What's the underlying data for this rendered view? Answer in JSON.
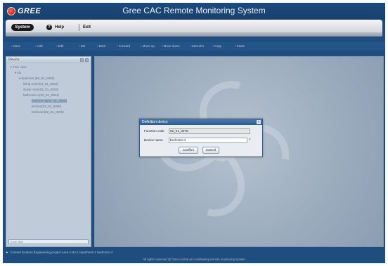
{
  "app": {
    "logo_text": "GREE",
    "title": "Gree CAC Remote Monitoring System"
  },
  "menu": {
    "system_label": "System",
    "help_label": "Help",
    "exit_label": "Exit"
  },
  "toolbar": {
    "items": [
      "Save",
      "Add",
      "Edit",
      "Del",
      "Back",
      "Forward",
      "Move up",
      "Move down",
      "SetColor",
      "Copy",
      "Paste"
    ]
  },
  "left_panel": {
    "header": "Device",
    "tree": [
      "Tree view",
      "N1",
      "bedroom (02_01_0001)",
      "living room(02_01_0002)",
      "study room(02_01_0003)",
      "bathroom A(02_01_0004)",
      "bedroom B(02_01_0005)",
      "kitchen(02_01_0006)",
      "bedroom(02_01_0006)"
    ],
    "search_placeholder": "Enter filter"
  },
  "dialog": {
    "title": "Definition device",
    "function_code_label": "Function code",
    "function_code_value": "02_01_0076",
    "device_name_label": "Device name",
    "device_name_value": "bedroom d",
    "required_mark": "*",
    "confirm_label": "Confirm",
    "cancel_label": "Cancel",
    "close_glyph": "x"
  },
  "status": {
    "path_text": "Current location:Engineering project Area A No.1 Apartment 1 bedroom d"
  },
  "footer": {
    "text": "All rights reserved @ Gree central air conditioning remote monitoring system"
  },
  "colors": {
    "frame": "#1f4d7f",
    "dialog_title": "#2c5a92",
    "panel": "#bfcbd8"
  }
}
